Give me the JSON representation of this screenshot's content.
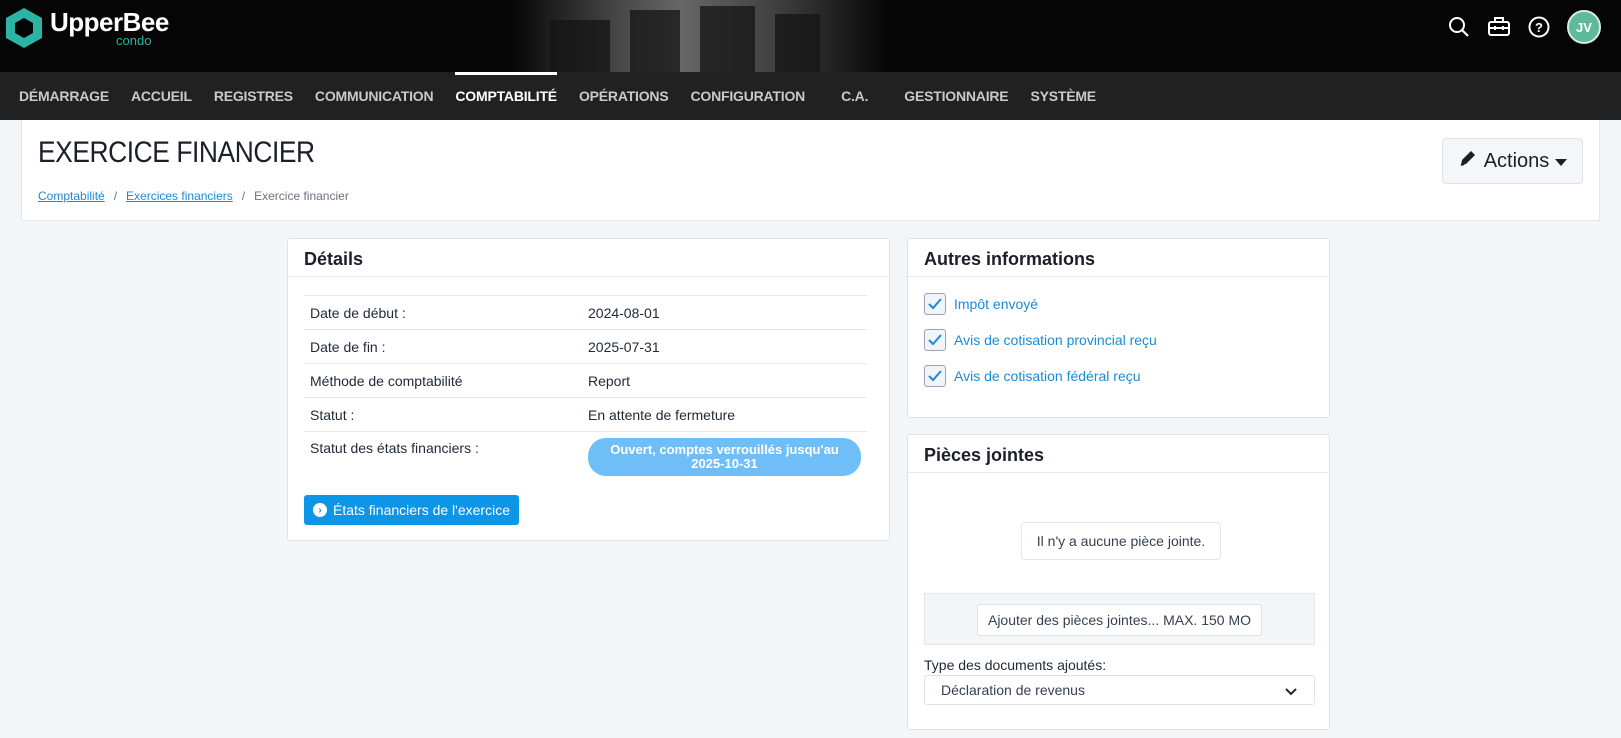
{
  "brand": {
    "name": "UpperBee",
    "sub": "condo"
  },
  "user": {
    "initials": "JV"
  },
  "icons": {
    "search": "search-icon",
    "toolbox": "toolbox-icon",
    "help": "help-icon",
    "edit": "pencil-icon"
  },
  "nav": {
    "items": [
      {
        "label": "DÉMARRAGE"
      },
      {
        "label": "ACCUEIL"
      },
      {
        "label": "REGISTRES"
      },
      {
        "label": "COMMUNICATION"
      },
      {
        "label": "COMPTABILITÉ"
      },
      {
        "label": "OPÉRATIONS"
      },
      {
        "label": "CONFIGURATION"
      },
      {
        "label": "C.A."
      },
      {
        "label": "GESTIONNAIRE"
      },
      {
        "label": "SYSTÈME"
      }
    ],
    "active": "COMPTABILITÉ"
  },
  "header": {
    "title": "EXERCICE FINANCIER",
    "breadcrumb": [
      "Comptabilité",
      "Exercices financiers",
      "Exercice financier"
    ],
    "actions_label": "Actions"
  },
  "details": {
    "title": "Détails",
    "rows": [
      {
        "label": "Date de début :",
        "value": "2024-08-01"
      },
      {
        "label": "Date de fin :",
        "value": "2025-07-31"
      },
      {
        "label": "Méthode de comptabilité",
        "value": "Report"
      },
      {
        "label": "Statut :",
        "value": "En attente de fermeture"
      }
    ],
    "etats_label": "Statut des états financiers :",
    "etats_status": "Ouvert, comptes verrouillés jusqu'au 2025-10-31",
    "button_label": "États financiers de l'exercice"
  },
  "autres": {
    "title": "Autres informations",
    "checks": [
      {
        "label": "Impôt envoyé",
        "checked": true
      },
      {
        "label": "Avis de cotisation provincial reçu",
        "checked": true
      },
      {
        "label": "Avis de cotisation fédéral reçu",
        "checked": true
      }
    ]
  },
  "pieces": {
    "title": "Pièces jointes",
    "empty": "Il n'y a aucune pièce jointe.",
    "add_label": "Ajouter des pièces jointes... MAX. 150 MO",
    "type_label": "Type des documents ajoutés:",
    "type_value": "Déclaration de revenus"
  },
  "colors": {
    "accent": "#0d95e8",
    "brand_teal": "#2bb3a3",
    "nav_bg": "#212121",
    "status_pill": "#6fbef7"
  }
}
